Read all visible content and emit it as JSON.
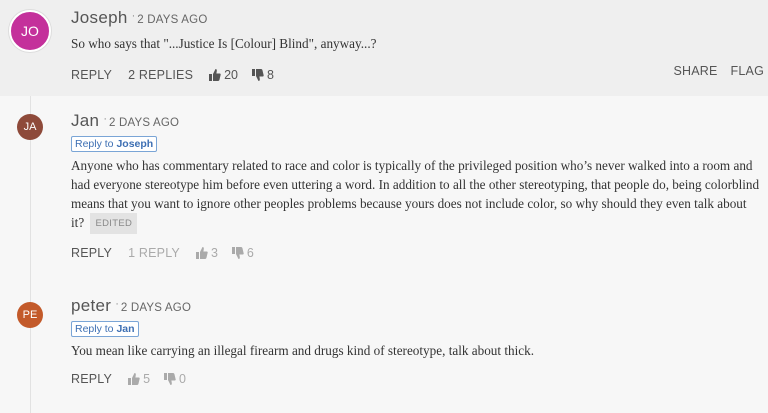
{
  "comments": [
    {
      "initials": "JO",
      "avatar_color": "#c4309b",
      "author": "Joseph",
      "time": "2 DAYS AGO",
      "text": "So who says that \"...Justice Is [Colour] Blind\", anyway...?",
      "reply_label": "REPLY",
      "replies_label": "2 REPLIES",
      "upvotes": "20",
      "downvotes": "8",
      "share_label": "SHARE",
      "flag_label": "FLAG"
    },
    {
      "initials": "JA",
      "avatar_color": "#8e4a3a",
      "author": "Jan",
      "time": "2 DAYS AGO",
      "reply_to_prefix": "Reply to",
      "reply_to_name": "Joseph",
      "text": "Anyone who has commentary related to race and color is typically of the privileged position who’s never walked into a room and had everyone stereotype him before even uttering a word. In addition to all the other stereotyping, that people do, being colorblind means that you want to ignore other peoples problems because yours does not include color, so why should they even talk about it?",
      "edited_label": "EDITED",
      "reply_label": "REPLY",
      "replies_label": "1 REPLY",
      "upvotes": "3",
      "downvotes": "6"
    },
    {
      "initials": "PE",
      "avatar_color": "#c35a2a",
      "author": "peter",
      "time": "2 DAYS AGO",
      "reply_to_prefix": "Reply to",
      "reply_to_name": "Jan",
      "text": "You mean like carrying an illegal firearm and drugs kind of stereotype, talk about thick.",
      "reply_label": "REPLY",
      "upvotes": "5",
      "downvotes": "0"
    }
  ],
  "icons": {
    "upvote": "thumbs-up-icon",
    "downvote": "thumbs-down-icon"
  }
}
